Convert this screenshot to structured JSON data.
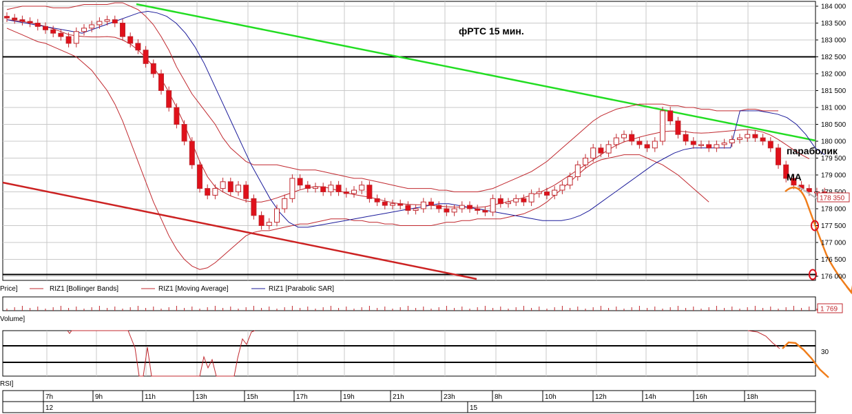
{
  "colors": {
    "candle_up": "#ffffff",
    "candle_down": "#e0101a",
    "bollinger": "#c0272d",
    "moving_average": "#c0272d",
    "parabolic_sar": "#1a1a9a",
    "resistance_trend": "#22dd22",
    "support_trend": "#cc2222",
    "forecast": "#f07d1a",
    "grid": "#c8c8c8",
    "level_line": "#000000"
  },
  "annotations": {
    "title": "фРТС   15 мин.",
    "parabolic_label": "параболик",
    "ma_label": "MA"
  },
  "legend": {
    "price": "Price]",
    "bollinger": "RIZ1 [Bollinger Bands]",
    "moving_average": "RIZ1 [Moving Average]",
    "parabolic": "RIZ1 [Parabolic SAR]"
  },
  "panels": {
    "volume_label": "Volume]",
    "volume_value": "1 769",
    "rsi_label": "RSI]",
    "rsi_level_label": "30"
  },
  "chart_data": {
    "type": "candlestick",
    "title": "фРТС   15 мин.",
    "instrument": "RIZ1",
    "y_ticks": [
      184000,
      183500,
      183000,
      182500,
      182000,
      181500,
      181000,
      180500,
      180000,
      179500,
      179000,
      178500,
      178000,
      177500,
      177000,
      176500,
      176000
    ],
    "y_tick_labels": [
      "184 000",
      "183 500",
      "183 000",
      "182 500",
      "182 000",
      "181 500",
      "181 000",
      "180 500",
      "180 000",
      "179 500",
      "179 000",
      "178 500",
      "178 000",
      "177 500",
      "177 000",
      "176 500",
      "176 000"
    ],
    "ylim": [
      176000,
      184000
    ],
    "last_price": 178350,
    "last_price_label": "178 350",
    "horizontal_levels": [
      182500,
      176050
    ],
    "x_ticks": [
      "7h",
      "9h",
      "11h",
      "13h",
      "15h",
      "17h",
      "19h",
      "21h",
      "23h",
      "8h",
      "10h",
      "12h",
      "14h",
      "16h",
      "18h"
    ],
    "date_labels": [
      "12",
      "15"
    ],
    "close": [
      183650,
      183600,
      183550,
      183500,
      183400,
      183300,
      183200,
      183100,
      182900,
      183250,
      183350,
      183450,
      183550,
      183600,
      183500,
      183100,
      182900,
      182700,
      182300,
      182000,
      181500,
      181000,
      180500,
      180000,
      179300,
      178600,
      178400,
      178600,
      178800,
      178500,
      178700,
      178300,
      177800,
      177500,
      177600,
      178000,
      178300,
      178900,
      178700,
      178600,
      178650,
      178500,
      178700,
      178500,
      178450,
      178550,
      178700,
      178300,
      178200,
      178100,
      178150,
      178100,
      177950,
      178000,
      178200,
      178100,
      178000,
      177900,
      178000,
      178100,
      178000,
      177950,
      177900,
      178300,
      178150,
      178200,
      178300,
      178200,
      178450,
      178500,
      178400,
      178550,
      178700,
      178950,
      179300,
      179500,
      179800,
      179650,
      179900,
      180100,
      180200,
      180000,
      179900,
      179800,
      180000,
      180900,
      180600,
      180200,
      180000,
      179900,
      179900,
      179800,
      179900,
      179950,
      180050,
      180100,
      180200,
      180100,
      180000,
      179800,
      179300,
      178900,
      178700,
      178600,
      178500,
      178500,
      178350
    ],
    "ma": [
      183600,
      183580,
      183550,
      183510,
      183460,
      183400,
      183330,
      183250,
      183160,
      183120,
      183100,
      183090,
      183090,
      183100,
      183080,
      183000,
      182880,
      182700,
      182480,
      182200,
      181850,
      181450,
      181000,
      180500,
      179950,
      179400,
      178950,
      178650,
      178500,
      178380,
      178300,
      178230,
      178200,
      178200,
      178250,
      178320,
      178400,
      178480,
      178560,
      178620,
      178660,
      178650,
      178600,
      178530,
      178470,
      178420,
      178380,
      178340,
      178290,
      178230,
      178180,
      178150,
      178130,
      178120,
      178110,
      178100,
      178080,
      178060,
      178050,
      178050,
      178040,
      178040,
      178060,
      178110,
      178160,
      178210,
      178270,
      178330,
      178400,
      178480,
      178580,
      178700,
      178850,
      179000,
      179150,
      179300,
      179450,
      179600,
      179750,
      179880,
      179980,
      180050,
      180120,
      180180,
      180230,
      180280,
      180300,
      180300,
      180280,
      180250,
      180240,
      180250,
      180270,
      180290,
      180310,
      180330,
      180340,
      180320,
      180270,
      180180,
      180050,
      179900,
      179740,
      179600,
      179480
    ],
    "bollinger_upper": [
      183900,
      183950,
      184000,
      184000,
      184000,
      184000,
      183950,
      183950,
      183950,
      184000,
      184050,
      184050,
      184050,
      184050,
      184100,
      184100,
      184000,
      183900,
      183700,
      183450,
      183100,
      182700,
      182200,
      181800,
      181400,
      181100,
      180800,
      180500,
      180100,
      179800,
      179600,
      179400,
      179300,
      179300,
      179300,
      179300,
      179250,
      179200,
      179150,
      179150,
      179150,
      179100,
      179050,
      179000,
      178950,
      178900,
      178900,
      178850,
      178800,
      178750,
      178700,
      178650,
      178600,
      178600,
      178600,
      178600,
      178550,
      178550,
      178500,
      178500,
      178500,
      178500,
      178550,
      178600,
      178700,
      178800,
      178900,
      179000,
      179100,
      179250,
      179400,
      179600,
      179800,
      180000,
      180200,
      180400,
      180600,
      180750,
      180850,
      180950,
      181000,
      181050,
      181100,
      181100,
      181100,
      181100,
      181050,
      181050,
      181000,
      181000,
      180950,
      180950,
      180900,
      180900,
      180900,
      180900,
      180950,
      180950,
      180900,
      180900,
      180900
    ],
    "bollinger_lower": [
      183350,
      183250,
      183150,
      183050,
      182950,
      182900,
      182800,
      182700,
      182600,
      182500,
      182300,
      182100,
      181800,
      181500,
      181100,
      180600,
      180000,
      179400,
      178800,
      178200,
      177700,
      177200,
      176800,
      176500,
      176300,
      176200,
      176250,
      176400,
      176600,
      176800,
      177000,
      177200,
      177300,
      177350,
      177350,
      177400,
      177450,
      177500,
      177550,
      177550,
      177600,
      177650,
      177700,
      177700,
      177700,
      177650,
      177650,
      177600,
      177600,
      177550,
      177550,
      177500,
      177500,
      177500,
      177500,
      177500,
      177550,
      177600,
      177600,
      177650,
      177650,
      177700,
      177700,
      177700,
      177700,
      177750,
      177800,
      177850,
      177950,
      178050,
      178200,
      178400,
      178600,
      178800,
      179000,
      179200,
      179350,
      179450,
      179500,
      179550,
      179600,
      179600,
      179600,
      179500,
      179400,
      179300,
      179150,
      179000,
      178800,
      178600,
      178400,
      178200
    ],
    "sar": [
      183600,
      183550,
      183500,
      183450,
      183400,
      183350,
      183300,
      183250,
      183200,
      183300,
      183400,
      183500,
      183600,
      183700,
      183800,
      183850,
      183800,
      183700,
      183500,
      183200,
      182800,
      182300,
      181700,
      181100,
      180500,
      179900,
      179300,
      178800,
      178300,
      177900,
      177600,
      177450,
      177450,
      177500,
      177550,
      177600,
      177650,
      177700,
      177750,
      177800,
      177850,
      177900,
      177950,
      178000,
      178050,
      178100,
      178150,
      178150,
      178100,
      178050,
      178000,
      177950,
      177900,
      177850,
      177800,
      177750,
      177700,
      177650,
      177650,
      177650,
      177700,
      177800,
      177950,
      178150,
      178350,
      178550,
      178750,
      178950,
      179150,
      179350,
      179500,
      179650,
      179750,
      179800,
      179800,
      179800,
      179800,
      179800,
      180900,
      180900,
      180900,
      180850,
      180800,
      180700,
      180500,
      180200,
      179800,
      179600
    ]
  }
}
